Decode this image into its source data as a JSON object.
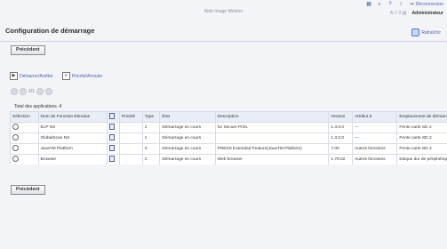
{
  "app_title": "Web Image Monitor",
  "top": {
    "logout_label": "Déconnexion",
    "user_label": "Administrateur"
  },
  "page": {
    "title": "Configuration de démarrage",
    "refresh_label": "Rafraîchir",
    "back_label_top": "Précédent",
    "back_label_bottom": "Précédent"
  },
  "actions": {
    "start_stop_label": "Démarrer/Arrêter",
    "priority_cancel_label": "Priorité/Annuler"
  },
  "pager": {
    "text": "1/1"
  },
  "table": {
    "total_label": "Total des applications :4",
    "headers": [
      "Sélection",
      "Nom de Fonction Étendue",
      "",
      "Priorité",
      "Type",
      "État",
      "Description",
      "Version",
      "Attribut à",
      "Emplacement de démarrage"
    ],
    "rows": [
      [
        "",
        "ELP NX",
        "",
        "",
        "J",
        "Démarrage en cours",
        "for Secure Print.",
        "1.3.0.0",
        "---",
        "Fente carte SD 2"
      ],
      [
        "",
        "GlobalScan NX",
        "",
        "",
        "J",
        "Démarrage en cours",
        "",
        "1.3.0.0",
        "---",
        "Fente carte SD 2"
      ],
      [
        "",
        "JavaTM Platform",
        "",
        "",
        "C",
        "Démarrage en cours",
        "PRESS Extended Feature(JavaTM Platform)",
        "7.00",
        "Autres fonctions",
        "Fente carte SD 2"
      ],
      [
        "",
        "Browser",
        "",
        "",
        "C",
        "Démarrage en cours",
        "Web browser",
        "1.79.02",
        "Autres fonctions",
        "Disque dur de périphérique"
      ]
    ]
  },
  "colors": {
    "background": "#f3f4f8",
    "accent": "#4f63a3"
  },
  "icons": {
    "grid": "grid-icon",
    "search": "search-icon",
    "help": "help-icon",
    "info": "info-icon",
    "logout": "logout-icon",
    "refresh": "refresh-icon",
    "start_stop": "start-stop-icon",
    "priority": "priority-icon"
  }
}
